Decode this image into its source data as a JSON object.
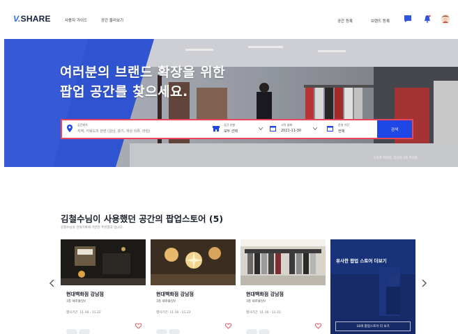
{
  "header": {
    "logo_mark": "V.",
    "logo_text": "SHARE",
    "nav": [
      "사용자 가이드",
      "공간 둘러보기"
    ],
    "links": [
      "공간 등록",
      "브랜드 등록"
    ],
    "icons": [
      "chat-icon",
      "notification-icon",
      "avatar"
    ]
  },
  "hero": {
    "title_line1": "여러분의 브랜드 확장을 위한",
    "title_line2": "팝업 공간를 찾으세요.",
    "caption": "신세계 백화점, 강남점 3층 여성몰"
  },
  "search": {
    "location_label": "공간위치",
    "location_placeholder": "지역, 키워드의 관련 (강남, 광기, 개성 의류, 라임)",
    "type_label": "공간 유형",
    "type_value": "모두 선택",
    "date_label": "시작 날짜",
    "date_value": "2021-11-30",
    "period_label": "운영 기간",
    "period_value": "전체",
    "button_label": "검색",
    "accent": "#e8475b",
    "button_color": "#1f47e6"
  },
  "section": {
    "title": "김철수님이 사용했던 공간의 팝업스토어 (5)",
    "subtitle": "김철수님의 검색기록에 기반한 추천결과 입니다.",
    "cards": [
      {
        "name": "현대백화점 강남점",
        "floor": "3층 새로몰일V",
        "period_label": "행사기간",
        "period": "11.16 - 11.22"
      },
      {
        "name": "현대백화점 강남점",
        "floor": "3층 새로몰일V",
        "period_label": "행사기간",
        "period": "11.16 - 11.22"
      },
      {
        "name": "현대백화점 강남점",
        "floor": "3층 새로몰일V",
        "period_label": "행사기간",
        "period": "11.16 - 11.22"
      }
    ],
    "more": {
      "title": "유사한 팝업 스토어 더보기",
      "button": "18개 팝업스토어 더 보기"
    }
  }
}
